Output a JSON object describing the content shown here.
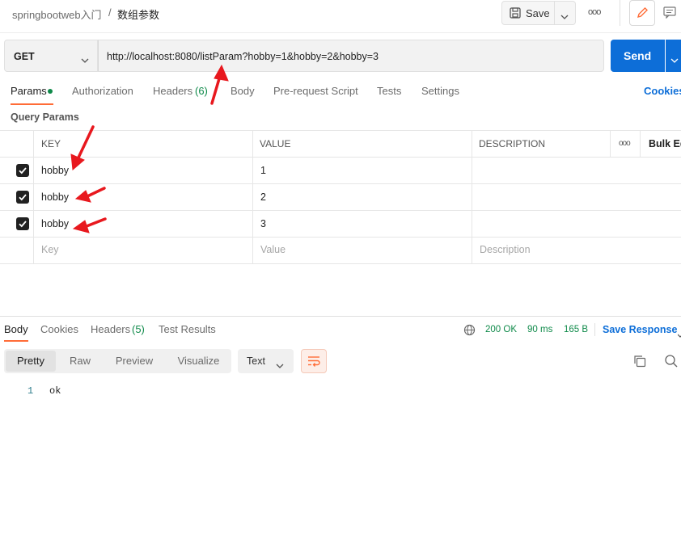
{
  "breadcrumb": {
    "collection": "springbootweb入门",
    "separator": "/",
    "request": "数组参数"
  },
  "toolbar": {
    "save_label": "Save",
    "more": "ooo"
  },
  "request": {
    "method": "GET",
    "url": "http://localhost:8080/listParam?hobby=1&hobby=2&hobby=3",
    "send_label": "Send"
  },
  "tabs": {
    "params": "Params",
    "authorization": "Authorization",
    "headers": "Headers",
    "headers_count": "(6)",
    "body": "Body",
    "prescript": "Pre-request Script",
    "tests": "Tests",
    "settings": "Settings",
    "cookies": "Cookies"
  },
  "query": {
    "title": "Query Params",
    "columns": {
      "key": "KEY",
      "value": "VALUE",
      "description": "DESCRIPTION",
      "more": "ooo",
      "bulk": "Bulk Ed"
    },
    "rows": [
      {
        "key": "hobby",
        "value": "1",
        "checked": true
      },
      {
        "key": "hobby",
        "value": "2",
        "checked": true
      },
      {
        "key": "hobby",
        "value": "3",
        "checked": true
      }
    ],
    "placeholders": {
      "key": "Key",
      "value": "Value",
      "description": "Description"
    }
  },
  "response": {
    "tabs": {
      "body": "Body",
      "cookies": "Cookies",
      "headers": "Headers",
      "headers_count": "(5)",
      "test_results": "Test Results"
    },
    "status": "200 OK",
    "time": "90 ms",
    "size": "165 B",
    "save_label": "Save Response",
    "views": {
      "pretty": "Pretty",
      "raw": "Raw",
      "preview": "Preview",
      "visualize": "Visualize"
    },
    "format": "Text",
    "lines": [
      {
        "num": "1",
        "text": "ok"
      }
    ]
  },
  "colors": {
    "accent": "#ff6c37",
    "send": "#0d6ed8",
    "status_ok": "#0f8a4a",
    "arrow": "#e8181e"
  }
}
